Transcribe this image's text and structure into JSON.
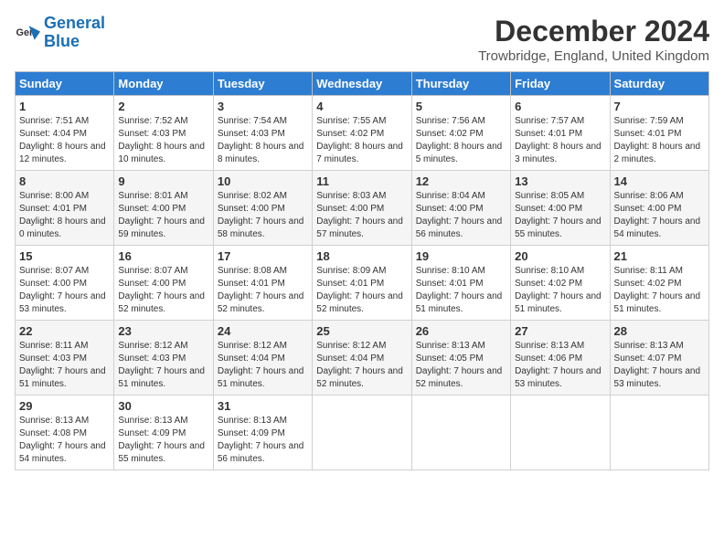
{
  "logo": {
    "line1": "General",
    "line2": "Blue"
  },
  "title": "December 2024",
  "location": "Trowbridge, England, United Kingdom",
  "headers": [
    "Sunday",
    "Monday",
    "Tuesday",
    "Wednesday",
    "Thursday",
    "Friday",
    "Saturday"
  ],
  "weeks": [
    [
      {
        "day": "1",
        "sunrise": "7:51 AM",
        "sunset": "4:04 PM",
        "daylight": "8 hours and 12 minutes."
      },
      {
        "day": "2",
        "sunrise": "7:52 AM",
        "sunset": "4:03 PM",
        "daylight": "8 hours and 10 minutes."
      },
      {
        "day": "3",
        "sunrise": "7:54 AM",
        "sunset": "4:03 PM",
        "daylight": "8 hours and 8 minutes."
      },
      {
        "day": "4",
        "sunrise": "7:55 AM",
        "sunset": "4:02 PM",
        "daylight": "8 hours and 7 minutes."
      },
      {
        "day": "5",
        "sunrise": "7:56 AM",
        "sunset": "4:02 PM",
        "daylight": "8 hours and 5 minutes."
      },
      {
        "day": "6",
        "sunrise": "7:57 AM",
        "sunset": "4:01 PM",
        "daylight": "8 hours and 3 minutes."
      },
      {
        "day": "7",
        "sunrise": "7:59 AM",
        "sunset": "4:01 PM",
        "daylight": "8 hours and 2 minutes."
      }
    ],
    [
      {
        "day": "8",
        "sunrise": "8:00 AM",
        "sunset": "4:01 PM",
        "daylight": "8 hours and 0 minutes."
      },
      {
        "day": "9",
        "sunrise": "8:01 AM",
        "sunset": "4:00 PM",
        "daylight": "7 hours and 59 minutes."
      },
      {
        "day": "10",
        "sunrise": "8:02 AM",
        "sunset": "4:00 PM",
        "daylight": "7 hours and 58 minutes."
      },
      {
        "day": "11",
        "sunrise": "8:03 AM",
        "sunset": "4:00 PM",
        "daylight": "7 hours and 57 minutes."
      },
      {
        "day": "12",
        "sunrise": "8:04 AM",
        "sunset": "4:00 PM",
        "daylight": "7 hours and 56 minutes."
      },
      {
        "day": "13",
        "sunrise": "8:05 AM",
        "sunset": "4:00 PM",
        "daylight": "7 hours and 55 minutes."
      },
      {
        "day": "14",
        "sunrise": "8:06 AM",
        "sunset": "4:00 PM",
        "daylight": "7 hours and 54 minutes."
      }
    ],
    [
      {
        "day": "15",
        "sunrise": "8:07 AM",
        "sunset": "4:00 PM",
        "daylight": "7 hours and 53 minutes."
      },
      {
        "day": "16",
        "sunrise": "8:07 AM",
        "sunset": "4:00 PM",
        "daylight": "7 hours and 52 minutes."
      },
      {
        "day": "17",
        "sunrise": "8:08 AM",
        "sunset": "4:01 PM",
        "daylight": "7 hours and 52 minutes."
      },
      {
        "day": "18",
        "sunrise": "8:09 AM",
        "sunset": "4:01 PM",
        "daylight": "7 hours and 52 minutes."
      },
      {
        "day": "19",
        "sunrise": "8:10 AM",
        "sunset": "4:01 PM",
        "daylight": "7 hours and 51 minutes."
      },
      {
        "day": "20",
        "sunrise": "8:10 AM",
        "sunset": "4:02 PM",
        "daylight": "7 hours and 51 minutes."
      },
      {
        "day": "21",
        "sunrise": "8:11 AM",
        "sunset": "4:02 PM",
        "daylight": "7 hours and 51 minutes."
      }
    ],
    [
      {
        "day": "22",
        "sunrise": "8:11 AM",
        "sunset": "4:03 PM",
        "daylight": "7 hours and 51 minutes."
      },
      {
        "day": "23",
        "sunrise": "8:12 AM",
        "sunset": "4:03 PM",
        "daylight": "7 hours and 51 minutes."
      },
      {
        "day": "24",
        "sunrise": "8:12 AM",
        "sunset": "4:04 PM",
        "daylight": "7 hours and 51 minutes."
      },
      {
        "day": "25",
        "sunrise": "8:12 AM",
        "sunset": "4:04 PM",
        "daylight": "7 hours and 52 minutes."
      },
      {
        "day": "26",
        "sunrise": "8:13 AM",
        "sunset": "4:05 PM",
        "daylight": "7 hours and 52 minutes."
      },
      {
        "day": "27",
        "sunrise": "8:13 AM",
        "sunset": "4:06 PM",
        "daylight": "7 hours and 53 minutes."
      },
      {
        "day": "28",
        "sunrise": "8:13 AM",
        "sunset": "4:07 PM",
        "daylight": "7 hours and 53 minutes."
      }
    ],
    [
      {
        "day": "29",
        "sunrise": "8:13 AM",
        "sunset": "4:08 PM",
        "daylight": "7 hours and 54 minutes."
      },
      {
        "day": "30",
        "sunrise": "8:13 AM",
        "sunset": "4:09 PM",
        "daylight": "7 hours and 55 minutes."
      },
      {
        "day": "31",
        "sunrise": "8:13 AM",
        "sunset": "4:09 PM",
        "daylight": "7 hours and 56 minutes."
      },
      null,
      null,
      null,
      null
    ]
  ]
}
